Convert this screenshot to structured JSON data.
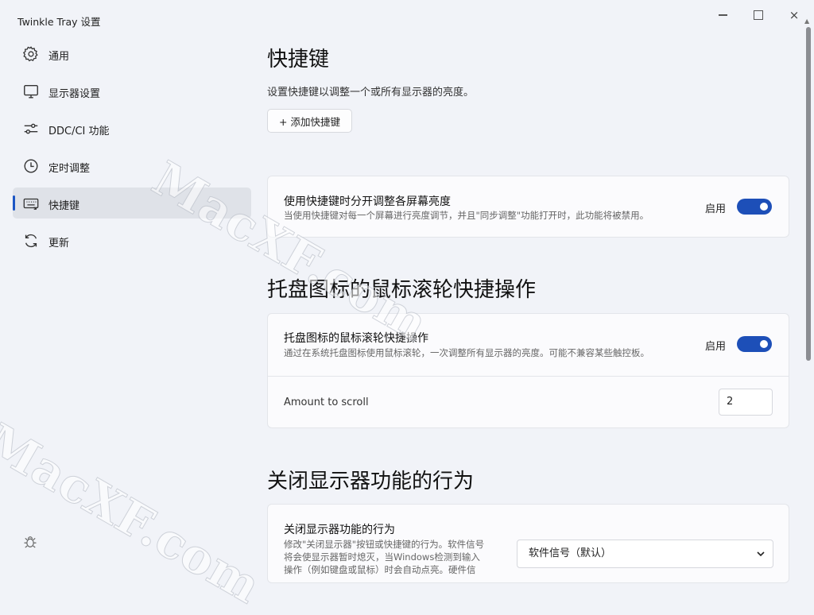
{
  "window": {
    "title": "Twinkle Tray 设置",
    "controls": {
      "minimize": "minimize",
      "maximize": "maximize",
      "close": "×"
    }
  },
  "sidebar": {
    "items": [
      {
        "label": "通用",
        "icon": "gear-icon"
      },
      {
        "label": "显示器设置",
        "icon": "monitor-icon"
      },
      {
        "label": "DDC/CI 功能",
        "icon": "sliders-icon"
      },
      {
        "label": "定时调整",
        "icon": "clock-icon"
      },
      {
        "label": "快捷键",
        "icon": "keyboard-icon",
        "active": true
      },
      {
        "label": "更新",
        "icon": "refresh-icon"
      }
    ],
    "bottom_icon": "bug-icon"
  },
  "main": {
    "hotkeys": {
      "title": "快捷键",
      "description": "设置快捷键以调整一个或所有显示器的亮度。",
      "add_button": "+ 添加快捷键",
      "separate_card": {
        "title": "使用快捷键时分开调整各屏幕亮度",
        "subtitle": "当使用快捷键对每一个屏幕进行亮度调节，并且\"同步调整\"功能打开时，此功能将被禁用。",
        "toggle_label": "启用",
        "toggle_on": true
      }
    },
    "tray_scroll": {
      "title": "托盘图标的鼠标滚轮快捷操作",
      "card_title": "托盘图标的鼠标滚轮快捷操作",
      "card_subtitle": "通过在系统托盘图标使用鼠标滚轮，一次调整所有显示器的亮度。可能不兼容某些触控板。",
      "toggle_label": "启用",
      "toggle_on": true,
      "amount_label": "Amount to scroll",
      "amount_value": "2"
    },
    "monitor_off": {
      "title": "关闭显示器功能的行为",
      "card_title": "关闭显示器功能的行为",
      "card_subtitle_lines": [
        "修改\"关闭显示器\"按钮或快捷键的行为。软件信号",
        "将会使显示器暂时熄灭，当Windows检测到输入",
        "操作（例如键盘或鼠标）时会自动点亮。硬件信"
      ],
      "select_value": "软件信号（默认）"
    }
  },
  "watermark": {
    "text": "MacXF.com"
  },
  "colors": {
    "accent": "#1d4fb8",
    "active_bar": "#1c56c4",
    "background": "#f1f3f8"
  }
}
